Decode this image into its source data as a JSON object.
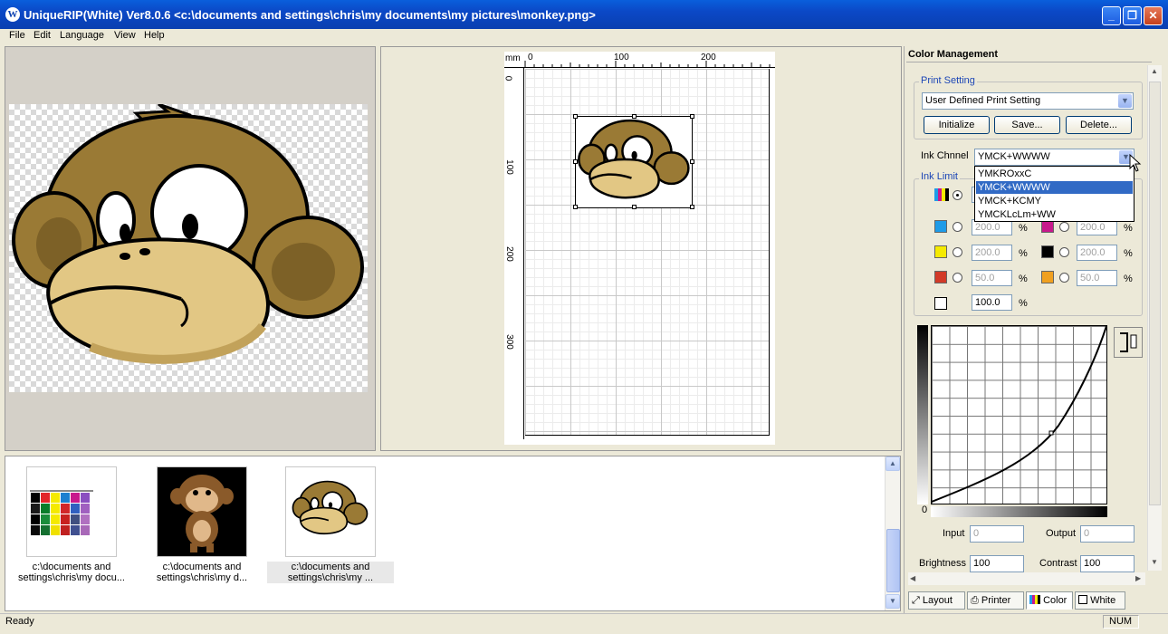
{
  "window": {
    "title": "UniqueRIP(White) Ver8.0.6 <c:\\documents and settings\\chris\\my documents\\my pictures\\monkey.png>",
    "logo_letter": "W",
    "minimize_glyph": "_",
    "maximize_glyph": "❐",
    "close_glyph": "✕"
  },
  "menu": [
    "File",
    "Edit",
    "Language",
    "View",
    "Help"
  ],
  "ruler": {
    "unit": "mm",
    "top_labels": [
      "0",
      "100",
      "200"
    ],
    "left_labels": [
      "0",
      "100",
      "200",
      "300"
    ]
  },
  "thumbnails": [
    {
      "caption_line1": "c:\\documents and",
      "caption_line2": "settings\\chris\\my docu..."
    },
    {
      "caption_line1": "c:\\documents and",
      "caption_line2": "settings\\chris\\my d..."
    },
    {
      "caption_line1": "c:\\documents and",
      "caption_line2": "settings\\chris\\my ..."
    }
  ],
  "color_mgmt": {
    "title": "Color Management",
    "print_setting_title": "Print Setting",
    "print_setting_value": "User Defined Print Setting",
    "initialize_label": "Initialize",
    "save_label": "Save...",
    "delete_label": "Delete...",
    "ink_channel_label": "Ink Chnnel",
    "ink_channel_value": "YMCK+WWWW",
    "ink_channel_options": [
      "YMKROxxC",
      "YMCK+WWWW",
      "YMCK+KCMY",
      "YMCKLcLm+WW"
    ],
    "ink_limit_title": "Ink Limit",
    "limits": [
      {
        "color": "#1e9be8",
        "value": "200.0",
        "pct": "%"
      },
      {
        "color": "#c8198c",
        "value": "200.0",
        "pct": "%"
      },
      {
        "color": "#f5ea00",
        "value": "200.0",
        "pct": "%"
      },
      {
        "color": "#000000",
        "value": "200.0",
        "pct": "%"
      },
      {
        "color": "#d23a28",
        "value": "50.0",
        "pct": "%"
      },
      {
        "color": "#f0a020",
        "value": "50.0",
        "pct": "%"
      }
    ],
    "white_limit": {
      "value": "100.0",
      "pct": "%"
    },
    "curve_origin_label": "0",
    "input_label": "Input",
    "input_value": "0",
    "output_label": "Output",
    "output_value": "0",
    "brightness_label": "Brightness",
    "brightness_value": "100",
    "contrast_label": "Contrast",
    "contrast_value": "100"
  },
  "tabs": [
    {
      "label": "Layout",
      "icon": "layout-icon"
    },
    {
      "label": "Printer",
      "icon": "printer-icon"
    },
    {
      "label": "Color",
      "icon": "color-icon"
    },
    {
      "label": "White",
      "icon": "white-icon"
    }
  ],
  "status": {
    "left": "Ready",
    "right": "NUM"
  },
  "colors": {
    "title_bar": "#0b48c6",
    "selection": "#316ac5",
    "monkey_brown": "#9a7a35",
    "monkey_face": "#e2c784"
  }
}
